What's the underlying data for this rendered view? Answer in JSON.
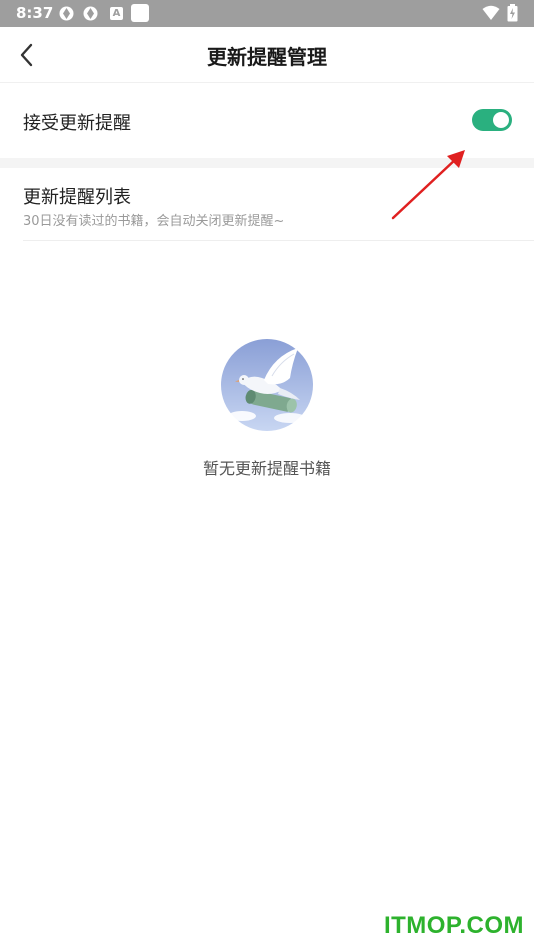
{
  "status_bar": {
    "time": "8:37",
    "icons": [
      "sync-icon",
      "sync-icon",
      "a-app-icon",
      "square-app-icon",
      "wifi-icon",
      "battery-icon"
    ],
    "a_label": "A"
  },
  "header": {
    "title": "更新提醒管理",
    "back_icon": "chevron-left-icon"
  },
  "settings": {
    "accept_label": "接受更新提醒",
    "accept_enabled": true,
    "accent_color": "#2ab07f"
  },
  "reminder_list": {
    "title": "更新提醒列表",
    "subtitle": "30日没有读过的书籍，会自动关闭更新提醒~"
  },
  "empty_state": {
    "illustration": "dove-with-scroll-icon",
    "message": "暂无更新提醒书籍"
  },
  "annotation": {
    "arrow_color": "#e02020"
  },
  "watermark": {
    "text": "ITMOP.COM"
  }
}
